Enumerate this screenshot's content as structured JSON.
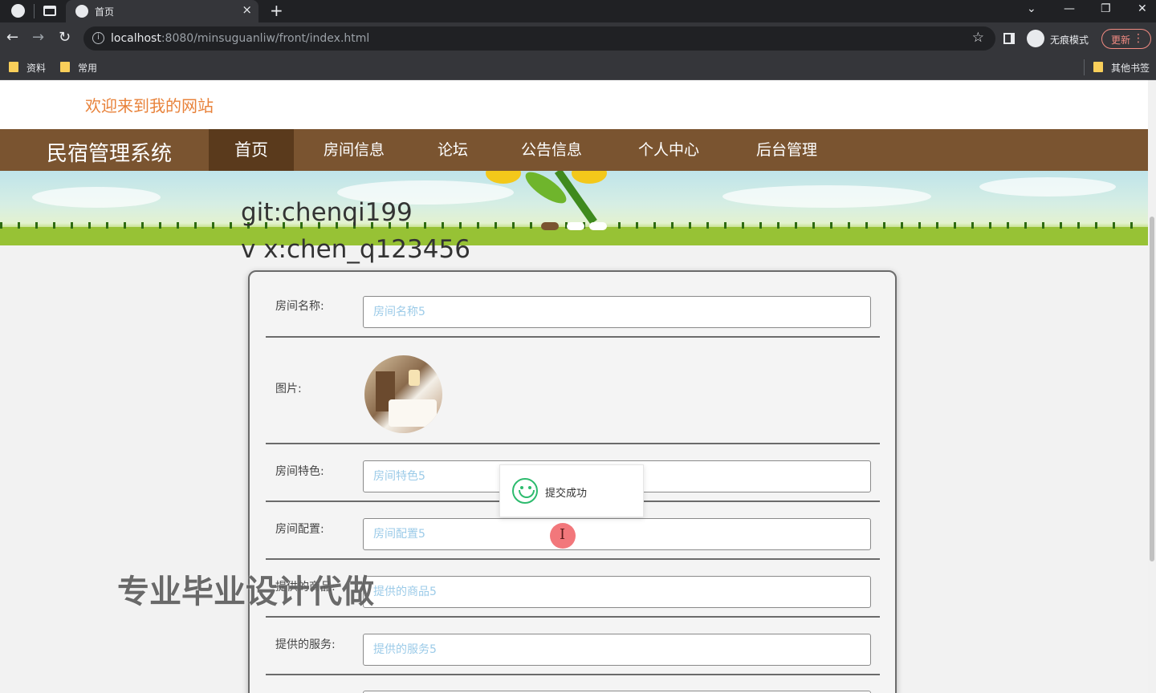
{
  "browser": {
    "tab_title": "首页",
    "tab_close": "×",
    "new_tab": "+",
    "minimize": "—",
    "restore": "❐",
    "close": "✕",
    "tab_search": "⌄",
    "url_host": "localhost",
    "url_rest": ":8080/minsuguanliw/front/index.html",
    "incognito_label": "无痕模式",
    "update_label": "更新",
    "bookmarks": [
      "资料",
      "常用"
    ],
    "other_bookmarks": "其他书签"
  },
  "site": {
    "welcome": "欢迎来到我的网站",
    "brand": "民宿管理系统",
    "nav": [
      "首页",
      "房间信息",
      "论坛",
      "公告信息",
      "个人中心",
      "后台管理"
    ],
    "active_nav_index": 0
  },
  "overlay": {
    "line1": "git:chenqi199",
    "line2": "v x:chen_q123456",
    "watermark": "专业毕业设计代做"
  },
  "form": {
    "rows": [
      {
        "label": "房间名称:",
        "value": "房间名称5"
      },
      {
        "label": "图片:",
        "value": ""
      },
      {
        "label": "房间特色:",
        "value": "房间特色5"
      },
      {
        "label": "房间配置:",
        "value": "房间配置5"
      },
      {
        "label": "提供的商品:",
        "value": "提供的商品5"
      },
      {
        "label": "提供的服务:",
        "value": "提供的服务5"
      }
    ]
  },
  "toast": {
    "message": "提交成功"
  },
  "icons": {
    "cursor": "I",
    "star": "☆",
    "menu": "⋮",
    "back": "←",
    "forward": "→",
    "reload": "↻"
  },
  "colors": {
    "nav_bg": "#7a5430",
    "nav_active": "#5a3a1c",
    "welcome": "#e8823a",
    "placeholder": "#9ccbe8",
    "success": "#2dbb6e"
  }
}
